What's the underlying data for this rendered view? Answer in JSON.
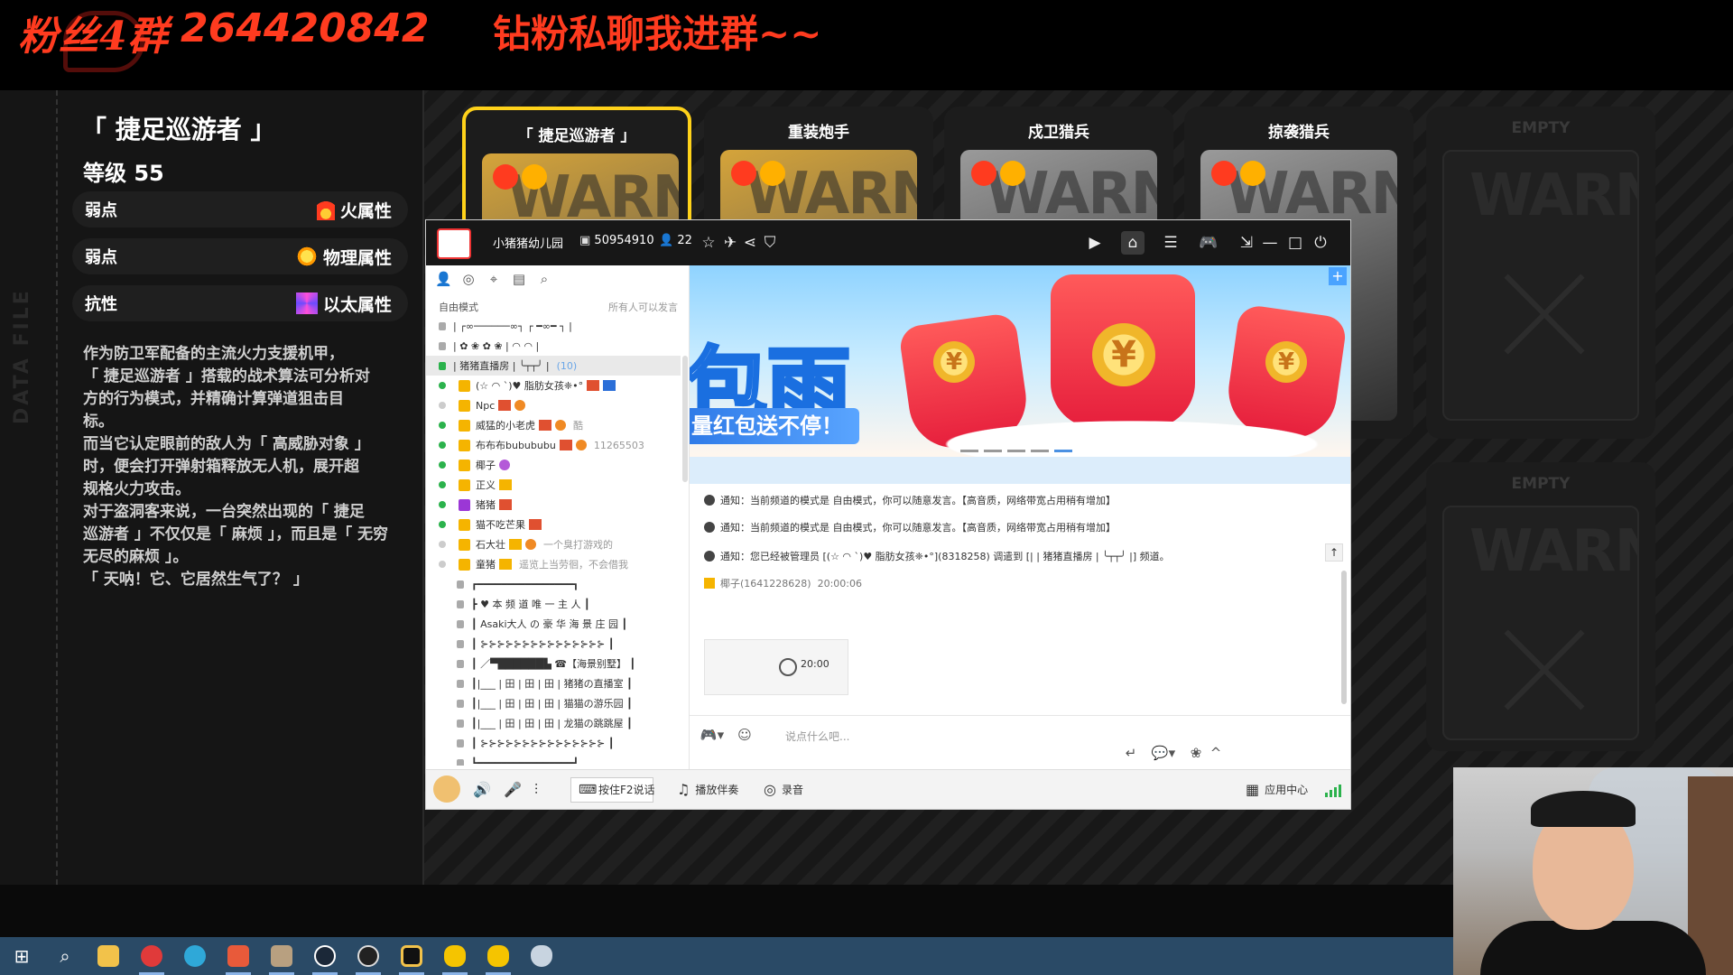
{
  "overlay": {
    "fan_group": "粉丝4群",
    "group_number": "264420842",
    "dm_text": "钻粉私聊我进群~~"
  },
  "character": {
    "name": "「 捷足巡游者 」",
    "level": "等级 55",
    "attributes": [
      {
        "key": "弱点",
        "value": "火属性",
        "icon": "fire-icon"
      },
      {
        "key": "弱点",
        "value": "物理属性",
        "icon": "physical-icon"
      },
      {
        "key": "抗性",
        "value": "以太属性",
        "icon": "ether-icon"
      }
    ],
    "description": [
      "作为防卫军配备的主流火力支援机甲，",
      "「 捷足巡游者 」搭载的战术算法可分析对",
      "方的行为模式，并精确计算弹道狙击目",
      "标。",
      "而当它认定眼前的敌人为「 高威胁对象 」",
      "时，便会打开弹射箱释放无人机，展开超",
      "规格火力攻击。",
      "对于盗洞客来说，一台突然出现的「 捷足",
      "巡游者 」不仅仅是「 麻烦 」，而且是「 无穷",
      "无尽的麻烦 」。",
      "「 天呐！它、它居然生气了？ 」"
    ],
    "side_label": "DATA FILE"
  },
  "cards": [
    {
      "name": "「 捷足巡游者 」",
      "warning": "WARNING",
      "state": "active"
    },
    {
      "name": "重装炮手",
      "warning": "WARNING",
      "state": "normal"
    },
    {
      "name": "戍卫猎兵",
      "warning": "WARNING",
      "state": "grey"
    },
    {
      "name": "掠袭猎兵",
      "warning": "WARNING",
      "state": "grey"
    },
    {
      "name": "EMPTY",
      "warning": "WARNING",
      "state": "empty"
    }
  ],
  "second_row": {
    "empty_label": "EMPTY",
    "warning": "WARNING"
  },
  "yy": {
    "channel_name": "小猪猪幼儿园",
    "channel_id": "50954910",
    "user_count": "22",
    "mode": "自由模式",
    "mode_right": "所有人可以发言",
    "list": [
      {
        "type": "lock",
        "text": "| ┌∞──────∞┐ ┌ ━∞━ ┐ |"
      },
      {
        "type": "lock",
        "text": "| ✿ ❀ ✿ ❀ | ◠ ◠ |"
      },
      {
        "type": "room",
        "text": "| 猪猪直播房 | ╰┬┬╯ |",
        "count": "(10)"
      },
      {
        "type": "user",
        "text": "(☆ ◠ `)♥ 脂肪女孩❈•°",
        "online": true
      },
      {
        "type": "user",
        "text": "Npc",
        "online": false
      },
      {
        "type": "user",
        "text": "威猛的小老虎",
        "tag": "酷",
        "online": true
      },
      {
        "type": "user",
        "text": "布布布bubububu",
        "tag": "11265503",
        "online": true
      },
      {
        "type": "user",
        "text": "椰子",
        "online": true
      },
      {
        "type": "user",
        "text": "正义",
        "online": true
      },
      {
        "type": "user",
        "text": "猪猪",
        "online": true,
        "purple": true
      },
      {
        "type": "user",
        "text": "猫不吃芒果",
        "online": true
      },
      {
        "type": "user",
        "text": "石大壮",
        "tag": "一个臭打游戏的",
        "online": false
      },
      {
        "type": "user",
        "text": "童猪",
        "tag": "遥览上当劳徊，不会借我",
        "online": false
      },
      {
        "type": "lock2",
        "text": "┏━━━━━━━━━━━━━━━━┓"
      },
      {
        "type": "lock2",
        "text": "┣ ♥ 本 频 道 唯 一 主 人 ┃"
      },
      {
        "type": "lock2",
        "text": "┃ Asaki大人 の 豪 华 海 景 庄 园 ┃"
      },
      {
        "type": "lock2",
        "text": "┃ ⊱⊱⊱⊱⊱⊱⊱⊱⊱⊱⊱⊱⊱⊱⊱ ┃"
      },
      {
        "type": "lock2",
        "text": "┃ ／▀██████▙ ☎【海景别墅】 ┃"
      },
      {
        "type": "lock2",
        "text": "┃|___ | 田 | 田 | 田 | 猪猪の直播室 ┃"
      },
      {
        "type": "lock2",
        "text": "┃|___ | 田 | 田 | 田 | 猫猫の游乐园 ┃"
      },
      {
        "type": "lock2",
        "text": "┃|___ | 田 | 田 | 田 | 龙猫の跳跳屋 ┃"
      },
      {
        "type": "lock2",
        "text": "┃ ⊱⊱⊱⊱⊱⊱⊱⊱⊱⊱⊱⊱⊱⊱⊱ ┃"
      },
      {
        "type": "lock2",
        "text": "┗━━━━━━━━━━━━━━━━┛"
      }
    ],
    "banner": {
      "big": "包雨",
      "sub": "量红包送不停！",
      "coin": "¥"
    },
    "messages": [
      {
        "prefix": "通知：",
        "text": "当前频道的模式是 自由模式，你可以随意发言。【高音质，网络带宽占用稍有增加】"
      },
      {
        "prefix": "通知：",
        "text": "当前频道的模式是 自由模式，你可以随意发言。【高音质，网络带宽占用稍有增加】"
      },
      {
        "prefix": "通知：",
        "text": "您已经被管理员 [(☆ ◠ `)♥ 脂肪女孩❈•°](8318258) 调遣到 [| | 猪猪直播房 | ╰┬┬╯ |] 频道。"
      }
    ],
    "user_msg": {
      "name": "椰子(1641228628)",
      "time": "20:00:06"
    },
    "thumb_time": "20:00",
    "input_placeholder": "说点什么吧...",
    "bottom": {
      "push_to_talk": "按住F2说话",
      "accompany": "播放伴奏",
      "record": "录音",
      "app_center": "应用中心"
    }
  },
  "taskbar": {
    "apps": [
      "windows-start-icon",
      "search-icon",
      "file-explorer-icon",
      "netease-music-icon",
      "edge-icon",
      "app-icon",
      "game-icon",
      "steam-icon",
      "obs-icon",
      "app-circle-icon",
      "yy-icon",
      "yy-icon-2",
      "shield-icon"
    ]
  },
  "colors": {
    "overlay_red": "#ff3b1f",
    "accent_yellow": "#ffd21a",
    "taskbar": "#2a4a66"
  }
}
